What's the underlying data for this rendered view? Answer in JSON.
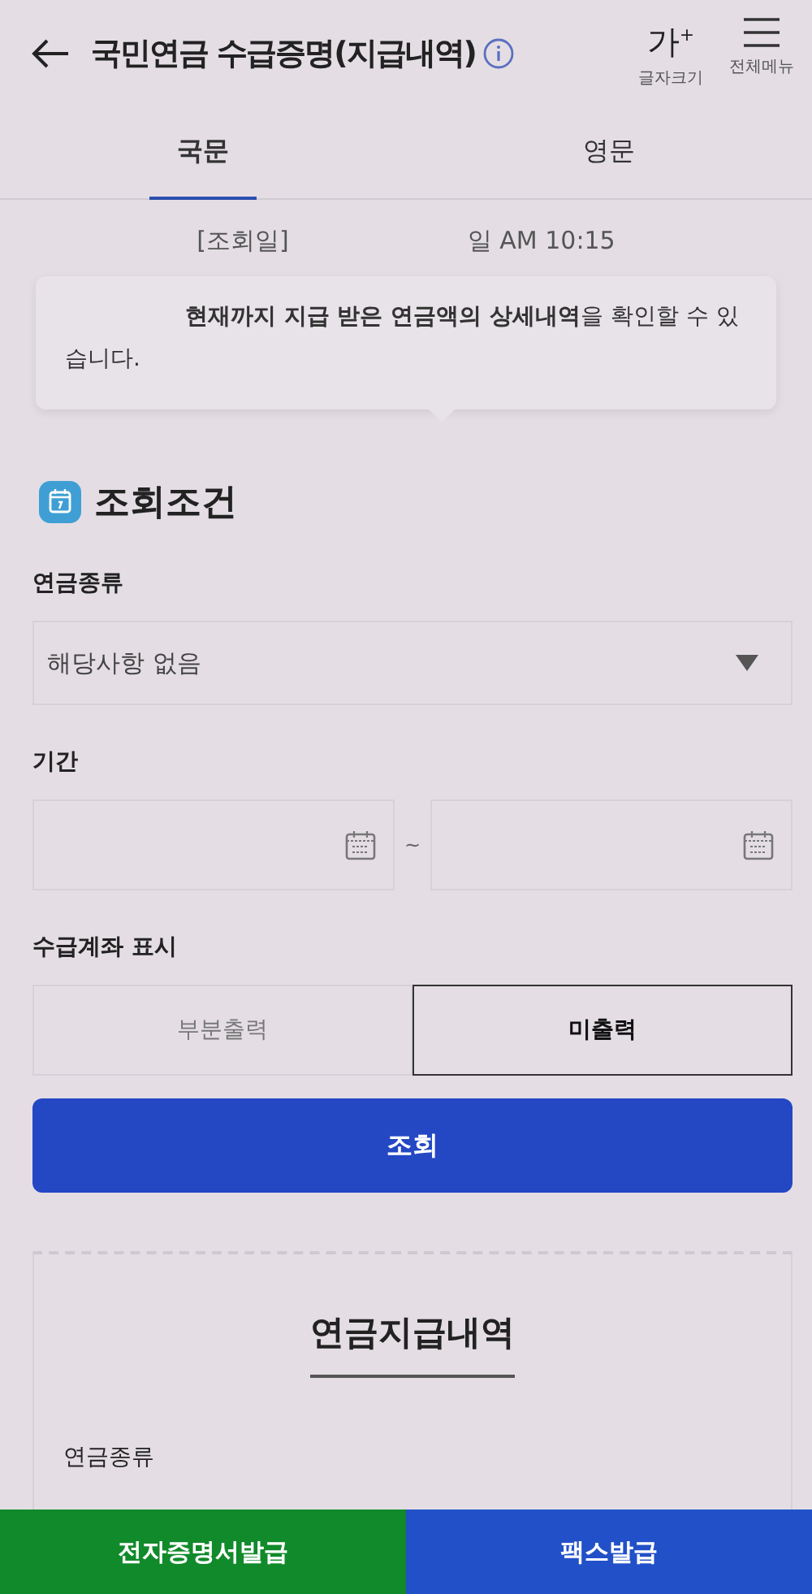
{
  "header": {
    "title": "국민연금 수급증명(지급내역)",
    "actions": [
      {
        "kind": "font",
        "glyph": "가",
        "sup": "+",
        "label": "글자크기"
      },
      {
        "kind": "menu",
        "label": "전체메뉴"
      }
    ]
  },
  "tabs": [
    {
      "label": "국문",
      "selected": true
    },
    {
      "label": "영문",
      "selected": false
    }
  ],
  "inquiry": {
    "label": "[조회일]",
    "value": "일 AM 10:15"
  },
  "notice": "**현재까지 지급 받은 연금액의 상세내역**을 확인할 수 있습니다.",
  "section_title": "조회조건",
  "pension_type": {
    "label": "연금종류",
    "value": "해당사항 없음"
  },
  "period": {
    "label": "기간",
    "separator": "~"
  },
  "account_display": {
    "label": "수급계좌 표시",
    "options": [
      {
        "label": "부분출력",
        "selected": false
      },
      {
        "label": "미출력",
        "selected": true
      }
    ]
  },
  "search_button": "조회",
  "result": {
    "title": "연금지급내역",
    "field_label": "연금종류"
  },
  "bottom_buttons": [
    {
      "label": "전자증명서발급",
      "kind": "green"
    },
    {
      "label": "팩스발급",
      "kind": "blue"
    }
  ]
}
